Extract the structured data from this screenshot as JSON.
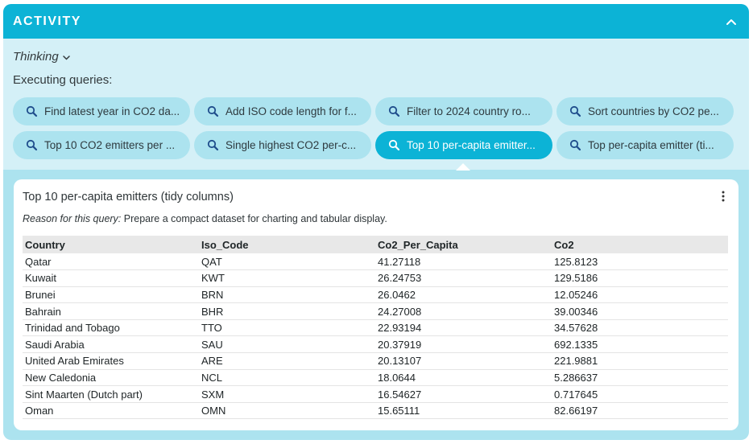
{
  "header": {
    "title": "ACTIVITY",
    "collapse_icon": "chevron-up-icon"
  },
  "thinking": {
    "label": "Thinking",
    "icon": "chevron-down-icon"
  },
  "executing_label": "Executing queries:",
  "queries": [
    {
      "label": "Find latest year in CO2 da...",
      "icon": "search-icon",
      "active": false
    },
    {
      "label": "Add ISO code length for f...",
      "icon": "search-icon",
      "active": false
    },
    {
      "label": "Filter to 2024 country ro...",
      "icon": "search-icon",
      "active": false
    },
    {
      "label": "Sort countries by CO2 pe...",
      "icon": "search-icon",
      "active": false
    },
    {
      "label": "Top 10 CO2 emitters per ...",
      "icon": "search-icon",
      "active": false
    },
    {
      "label": "Single highest CO2 per-c...",
      "icon": "search-icon",
      "active": false
    },
    {
      "label": "Top 10 per-capita emitter...",
      "icon": "search-icon",
      "active": true
    },
    {
      "label": "Top per-capita emitter (ti...",
      "icon": "search-icon",
      "active": false
    }
  ],
  "result": {
    "title": "Top 10 per-capita emitters (tidy columns)",
    "reason_label": "Reason for this query:",
    "reason_text": "Prepare a compact dataset for charting and tabular display.",
    "menu_icon": "kebab-menu-icon",
    "columns": [
      "Country",
      "Iso_Code",
      "Co2_Per_Capita",
      "Co2"
    ],
    "rows": [
      [
        "Qatar",
        "QAT",
        "41.27118",
        "125.8123"
      ],
      [
        "Kuwait",
        "KWT",
        "26.24753",
        "129.5186"
      ],
      [
        "Brunei",
        "BRN",
        "26.0462",
        "12.05246"
      ],
      [
        "Bahrain",
        "BHR",
        "24.27008",
        "39.00346"
      ],
      [
        "Trinidad and Tobago",
        "TTO",
        "22.93194",
        "34.57628"
      ],
      [
        "Saudi Arabia",
        "SAU",
        "20.37919",
        "692.1335"
      ],
      [
        "United Arab Emirates",
        "ARE",
        "20.13107",
        "221.9881"
      ],
      [
        "New Caledonia",
        "NCL",
        "18.0644",
        "5.286637"
      ],
      [
        "Sint Maarten (Dutch part)",
        "SXM",
        "16.54627",
        "0.717645"
      ],
      [
        "Oman",
        "OMN",
        "15.65111",
        "82.66197"
      ]
    ]
  },
  "colors": {
    "accent": "#0cb3d6",
    "panel": "#ace3ef",
    "top_area": "#d4f0f7",
    "chip": "#ace3ef"
  }
}
